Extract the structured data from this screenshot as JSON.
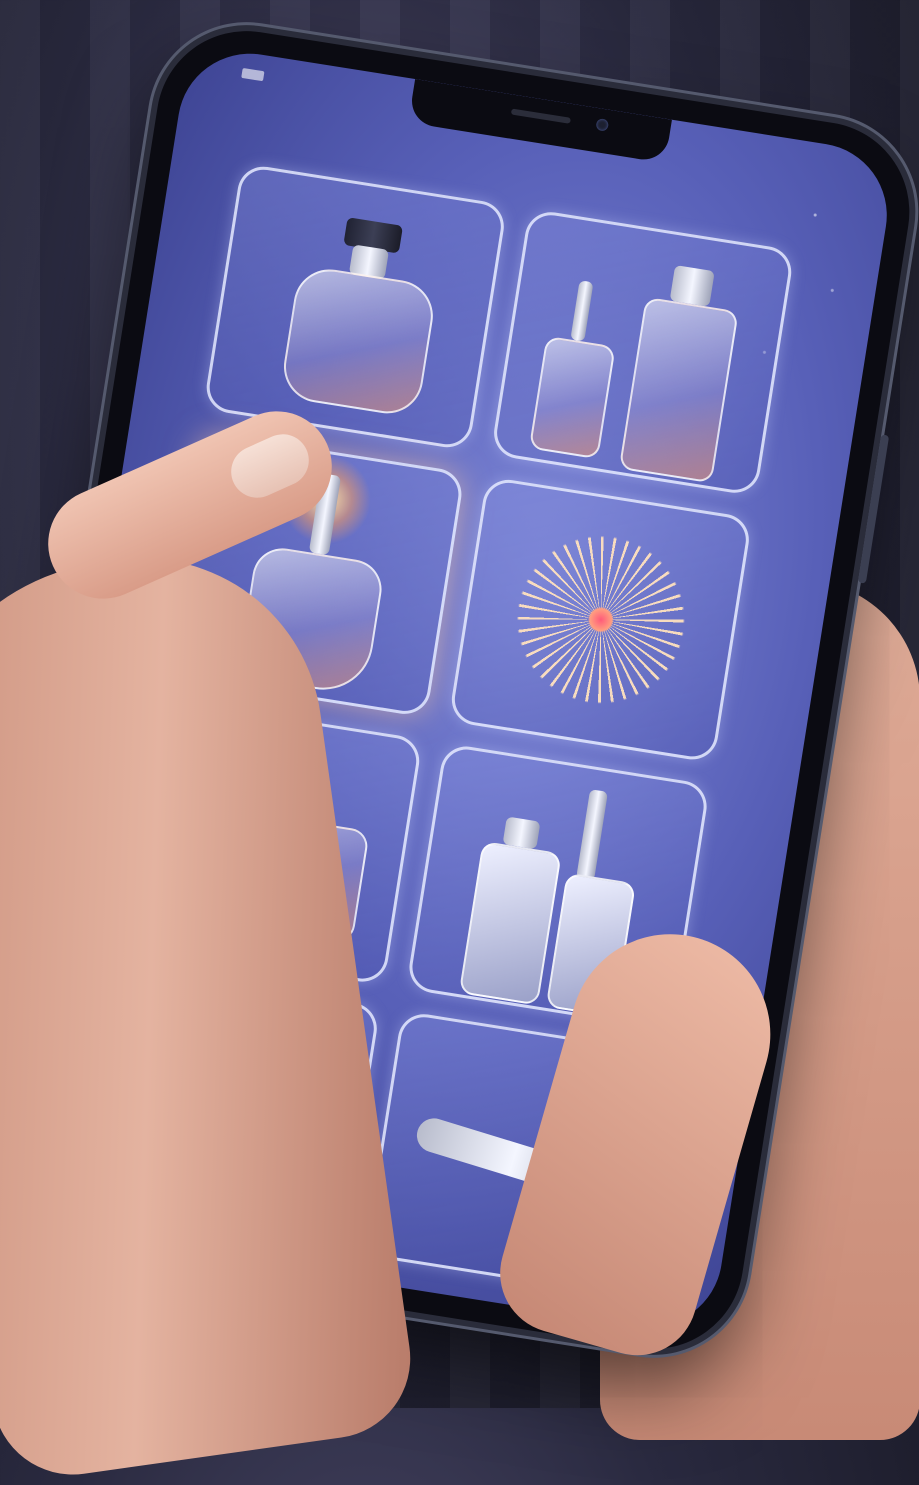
{
  "scene": {
    "description_visible_text": ""
  },
  "icons": [
    "perfume-bottle-icon",
    "serum-bottles-icon",
    "dropper-bottle-icon",
    "firework-icon",
    "cologne-bottle-icon",
    "spray-bottles-icon",
    "nail-polish-icon",
    "lipstick-icon"
  ],
  "colors": {
    "screen_accent": "#5860b8",
    "tile_border": "#e6ebff",
    "glow": "#ffc8a0"
  }
}
